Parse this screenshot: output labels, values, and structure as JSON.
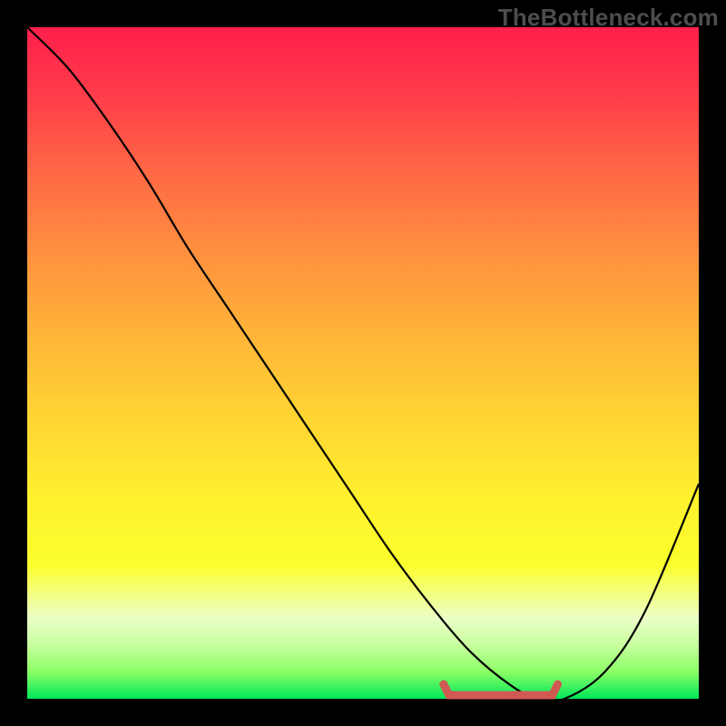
{
  "watermark": "TheBottleneck.com",
  "colors": {
    "background": "#000000",
    "gradient_top": "#ff1f4b",
    "gradient_bottom": "#00e659",
    "curve": "#000000",
    "highlight": "#d05a52"
  },
  "chart_data": {
    "type": "line",
    "title": "",
    "xlabel": "",
    "ylabel": "",
    "xlim": [
      0,
      100
    ],
    "ylim": [
      0,
      100
    ],
    "x": [
      0,
      6,
      12,
      18,
      24,
      30,
      36,
      42,
      48,
      54,
      60,
      66,
      72,
      76,
      80,
      86,
      92,
      100
    ],
    "y": [
      100,
      94,
      86,
      77,
      67,
      58,
      49,
      40,
      31,
      22,
      14,
      7,
      2,
      0,
      0,
      4,
      13,
      32
    ],
    "highlight_range": {
      "x_start": 62,
      "x_end": 79,
      "y": 0
    }
  }
}
